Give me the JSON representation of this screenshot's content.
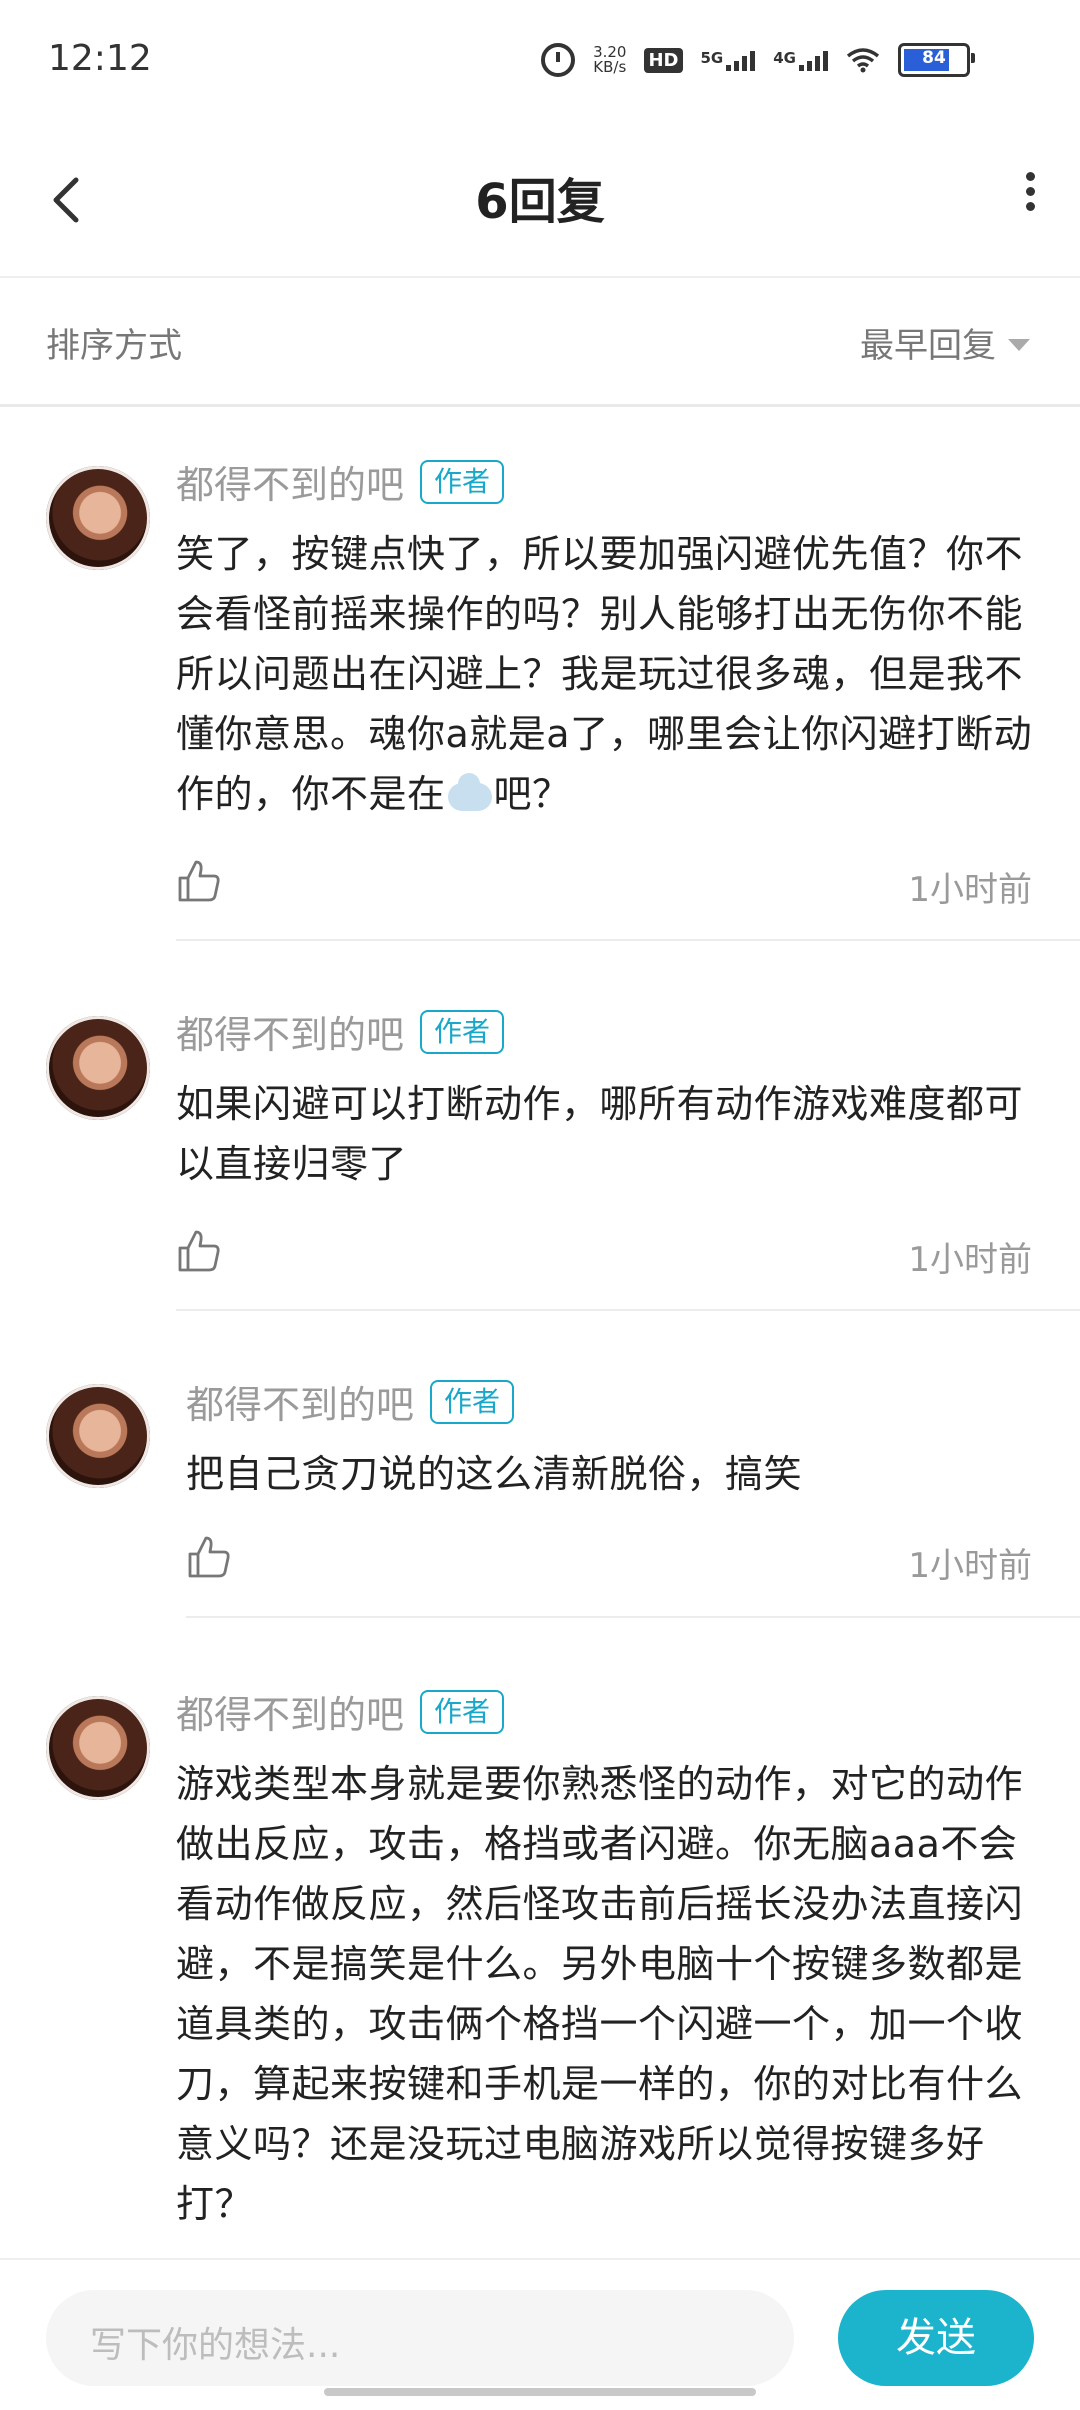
{
  "status_bar": {
    "time": "12:12",
    "net_speed_value": "3.20",
    "net_speed_unit": "KB/s",
    "hd_label": "HD",
    "sim1_label": "5G",
    "sim2_label": "4G",
    "battery": "84",
    "battery_level_fraction": 0.84,
    "battery_color": "#2b5fd8"
  },
  "header": {
    "title": "6回复",
    "back_icon": "chevron-left-icon",
    "more_icon": "more-vertical-icon"
  },
  "sort": {
    "label": "排序方式",
    "selected": "最早回复",
    "dropdown_icon": "triangle-down-icon"
  },
  "comments": [
    {
      "author": "都得不到的吧",
      "badge": "作者",
      "content_before_emoji": "笑了，按键点快了，所以要加强闪避优先值？你不会看怪前摇来操作的吗？别人能够打出无伤你不能所以问题出在闪避上？我是玩过很多魂，但是我不懂你意思。魂你a就是a了，哪里会让你闪避打断动作的，你不是在",
      "emoji": "cloud-emoji",
      "content_after_emoji": "吧？",
      "time": "1小时前"
    },
    {
      "author": "都得不到的吧",
      "badge": "作者",
      "content": "如果闪避可以打断动作，哪所有动作游戏难度都可以直接归零了",
      "time": "1小时前"
    },
    {
      "author": "都得不到的吧",
      "badge": "作者",
      "content": "把自己贪刀说的这么清新脱俗，搞笑",
      "time": "1小时前"
    },
    {
      "author": "都得不到的吧",
      "badge": "作者",
      "content": "游戏类型本身就是要你熟悉怪的动作，对它的动作做出反应，攻击，格挡或者闪避。你无脑aaa不会看动作做反应，然后怪攻击前后摇长没办法直接闪避，不是搞笑是什么。另外电脑十个按键多数都是道具类的，攻击俩个格挡一个闪避一个，加一个收刀，算起来按键和手机是一样的，你的对比有什么意义吗？还是没玩过电脑游戏所以觉得按键多好打？",
      "time": ""
    }
  ],
  "reply_bar": {
    "placeholder": "写下你的想法...",
    "send_label": "发送",
    "send_color": "#1cb3cc"
  }
}
